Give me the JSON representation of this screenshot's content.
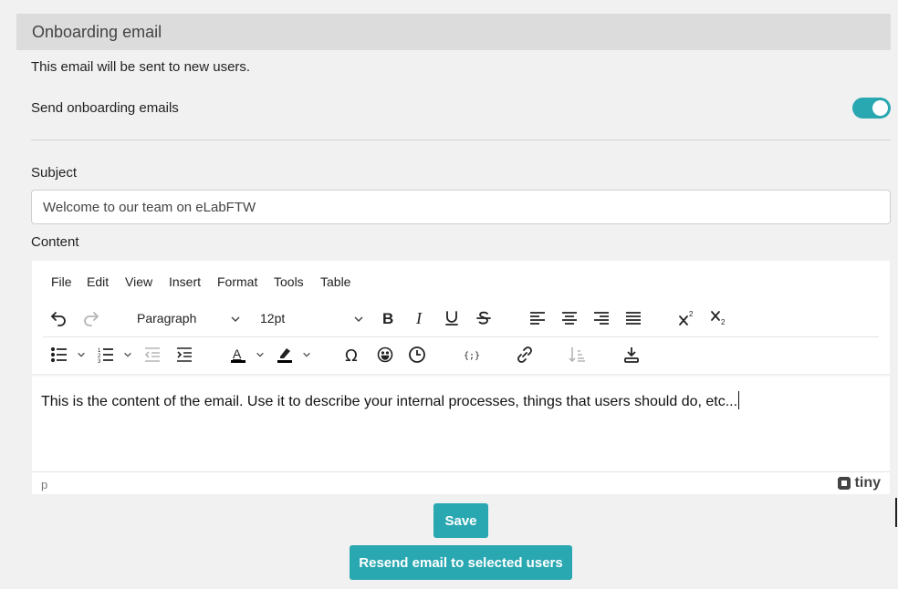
{
  "section": {
    "title": "Onboarding email",
    "description": "This email will be sent to new users."
  },
  "toggle": {
    "label": "Send onboarding emails",
    "state": "on",
    "accent_color": "#2aa8b1"
  },
  "subject": {
    "label": "Subject",
    "value": "Welcome to our team on eLabFTW"
  },
  "content": {
    "label": "Content",
    "menu": [
      "File",
      "Edit",
      "View",
      "Insert",
      "Format",
      "Tools",
      "Table"
    ],
    "block_format": "Paragraph",
    "font_size": "12pt",
    "body_text": "This is the content of the email. Use it to describe your internal processes, things that users should do, etc...",
    "status_path": "p",
    "branding": "tiny"
  },
  "toolbar_icons": {
    "row1": [
      "undo-icon",
      "redo-icon",
      "bold-icon",
      "italic-icon",
      "underline-icon",
      "strikethrough-icon",
      "align-left-icon",
      "align-center-icon",
      "align-right-icon",
      "align-justify-icon",
      "superscript-icon",
      "subscript-icon"
    ],
    "row2": [
      "bullet-list-icon",
      "numbered-list-icon",
      "outdent-icon",
      "indent-icon",
      "text-color-icon",
      "highlight-icon",
      "special-character-icon",
      "emoji-icon",
      "insert-time-icon",
      "code-sample-icon",
      "link-icon",
      "sort-icon",
      "download-icon"
    ]
  },
  "actions": {
    "save": "Save",
    "resend": "Resend email to selected users"
  }
}
